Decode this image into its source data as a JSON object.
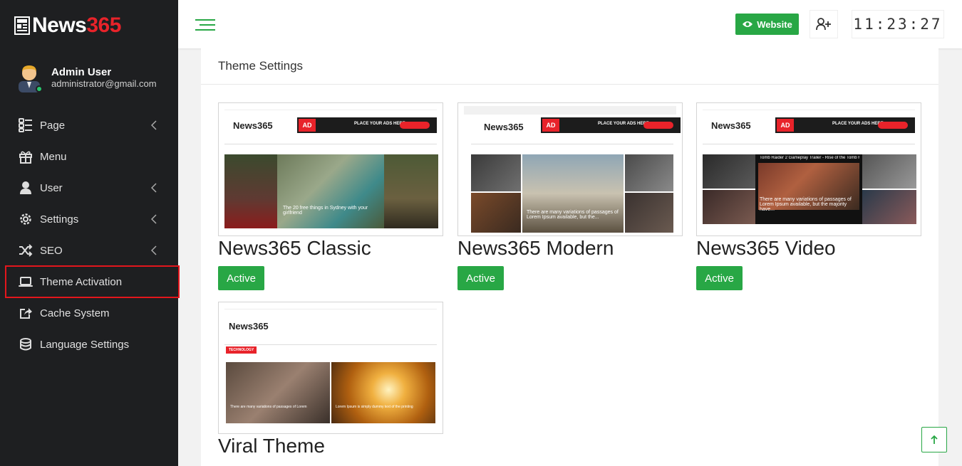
{
  "brand": {
    "name_part1": "News",
    "name_part2": "365"
  },
  "user": {
    "name": "Admin User",
    "email": "administrator@gmail.com"
  },
  "sidebar": {
    "items": [
      {
        "label": "Page",
        "icon": "page-icon",
        "has_submenu": true
      },
      {
        "label": "Menu",
        "icon": "gift-icon",
        "has_submenu": false
      },
      {
        "label": "User",
        "icon": "user-icon",
        "has_submenu": true
      },
      {
        "label": "Settings",
        "icon": "gear-icon",
        "has_submenu": true
      },
      {
        "label": "SEO",
        "icon": "shuffle-icon",
        "has_submenu": true
      },
      {
        "label": "Theme Activation",
        "icon": "laptop-icon",
        "has_submenu": false,
        "highlighted": true
      },
      {
        "label": "Cache System",
        "icon": "share-icon",
        "has_submenu": false
      },
      {
        "label": "Language Settings",
        "icon": "database-icon",
        "has_submenu": false
      }
    ]
  },
  "topbar": {
    "website_label": "Website",
    "clock": "11:23:27"
  },
  "main": {
    "panel_title": "Theme Settings",
    "themes": [
      {
        "name": "News365 Classic",
        "button": "Active"
      },
      {
        "name": "News365 Modern",
        "button": "Active"
      },
      {
        "name": "News365 Video",
        "button": "Active"
      },
      {
        "name": "Viral Theme",
        "button": ""
      }
    ]
  },
  "thumbs": {
    "logo": "News365",
    "ad_label": "AD",
    "ad_text": "PLACE YOUR ADS HERE",
    "classic_caption": "The 20 free things in Sydney with your girlfriend",
    "modern_caption": "There are many variations of passages of Lorem Ipsum available, but the...",
    "video_title": "Tomb Raider 2 Gameplay Trailer - Rise of the Tomb Raid...",
    "video_caption": "There are many variations of passages of Lorem Ipsum available, but the majority have...",
    "viral_tag": "TECHNOLOGY",
    "viral_caption1": "There are many variations of passages of Lorem",
    "viral_caption2": "Lorem Ipsum is simply dummy text of the printing"
  },
  "colors": {
    "sidebar_bg": "#1e1f21",
    "accent_green": "#28a745",
    "brand_red": "#e8232a",
    "highlight_red": "#e3161c"
  }
}
